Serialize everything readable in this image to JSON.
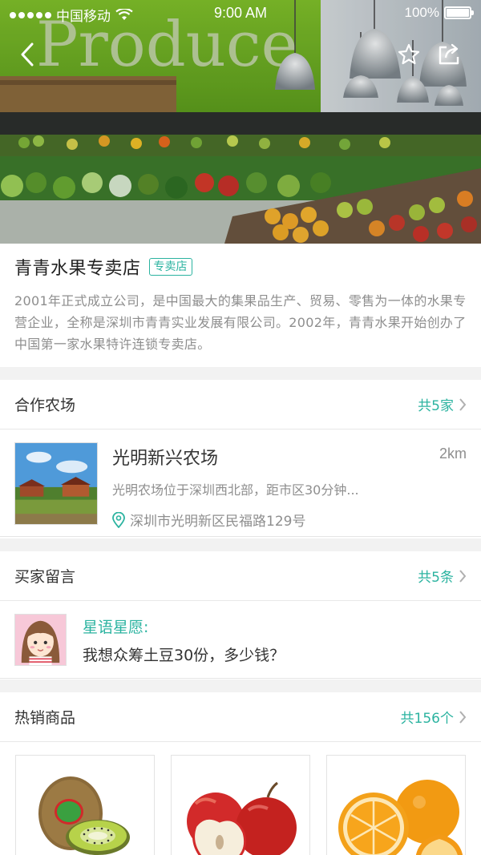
{
  "status_bar": {
    "carrier": "中国移动",
    "time": "9:00 AM",
    "battery": "100%"
  },
  "hero": {
    "sign_text": "Produce"
  },
  "store": {
    "name": "青青水果专卖店",
    "badge": "专卖店",
    "description": "2001年正式成立公司，是中国最大的集果品生产、贸易、零售为一体的水果专营企业，全称是深圳市青青实业发展有限公司。2002年，青青水果开始创办了中国第一家水果特许连锁专卖店。"
  },
  "farms": {
    "title": "合作农场",
    "more": "共5家",
    "items": [
      {
        "name": "光明新兴农场",
        "distance": "2km",
        "description": "光明农场位于深圳西北部，距市区30分钟...",
        "address": "深圳市光明新区民福路129号"
      }
    ]
  },
  "messages": {
    "title": "买家留言",
    "more": "共5条",
    "items": [
      {
        "user": "星语星愿:",
        "text": "我想众筹土豆30份，多少钱？"
      }
    ]
  },
  "hot_products": {
    "title": "热销商品",
    "more": "共156个",
    "items": [
      {
        "icon": "kiwi-icon"
      },
      {
        "icon": "apple-icon"
      },
      {
        "icon": "orange-icon"
      }
    ]
  },
  "colors": {
    "accent": "#2bb3a0",
    "text_primary": "#333333",
    "text_secondary": "#8e8e8e",
    "divider": "#f2f2f2"
  }
}
